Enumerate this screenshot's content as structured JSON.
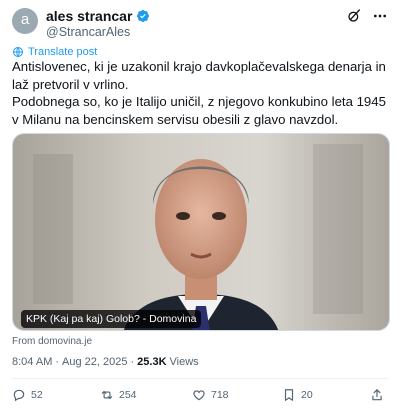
{
  "author": {
    "avatar_letter": "a",
    "display_name": "ales strancar",
    "handle": "@StrancarAles",
    "verified_color": "#1d9bf0"
  },
  "header_icons": [
    "grok-icon",
    "more-icon"
  ],
  "translate_label": "Translate post",
  "tweet_lines": [
    "Antislovenec, ki je uzakonil krajo davkoplačevalskega denarja in laž pretvoril v vrlino.",
    "Podobnega so, ko je Italijo uničil, z njegovo konkubino leta 1945 v Milanu na bencinskem servisu obesili z glavo navzdol."
  ],
  "media": {
    "caption": "KPK (Kaj pa kaj) Golob? - Domovina"
  },
  "source": "From domovina.je",
  "meta": {
    "time": "8:04 AM",
    "separator": "·",
    "date": "Aug 22, 2025",
    "views_count": "25.3K",
    "views_label": "Views"
  },
  "actions": {
    "replies": "52",
    "reposts": "254",
    "likes": "718",
    "bookmarks": "20"
  },
  "colors": {
    "accent": "#1d9bf0",
    "text": "#0f1419",
    "secondary": "#536471"
  }
}
